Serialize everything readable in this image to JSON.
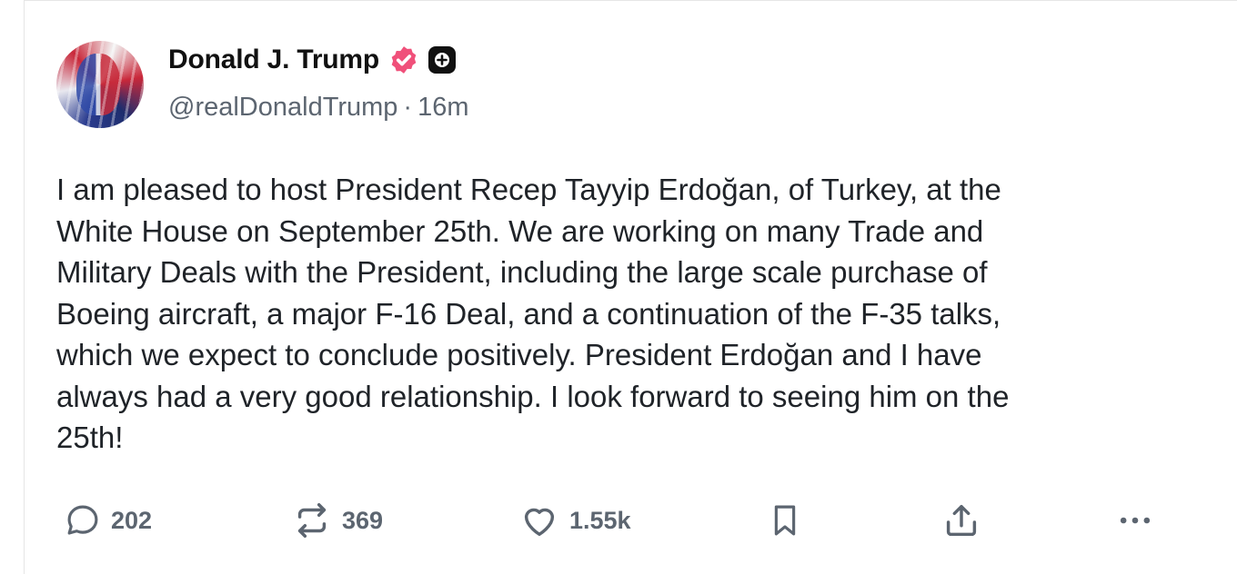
{
  "post": {
    "author": {
      "display_name": "Donald J. Trump",
      "handle": "@realDonaldTrump",
      "time_ago": "16m",
      "separator": "·",
      "avatar_icon": "avatar-image",
      "verified_icon": "verified-badge-icon",
      "verified_color": "#f0507a",
      "plus_icon": "plus-badge-icon"
    },
    "text": "I am pleased to host President Recep Tayyip Erdoğan, of Turkey, at the\nWhite House on September 25th. We are working on many Trade and\nMilitary Deals with the President, including the large scale purchase of\nBoeing aircraft, a major F-16 Deal, and a continuation of the F-35 talks,\nwhich we expect to conclude positively. President Erdoğan and I have\nalways had a very good relationship. I look forward to seeing him on the\n25th!",
    "actions": {
      "reply_count": "202",
      "repost_count": "369",
      "like_count": "1.55k"
    }
  },
  "colors": {
    "text": "#1f2328",
    "muted": "#5c6570",
    "icon": "#5c6570"
  }
}
